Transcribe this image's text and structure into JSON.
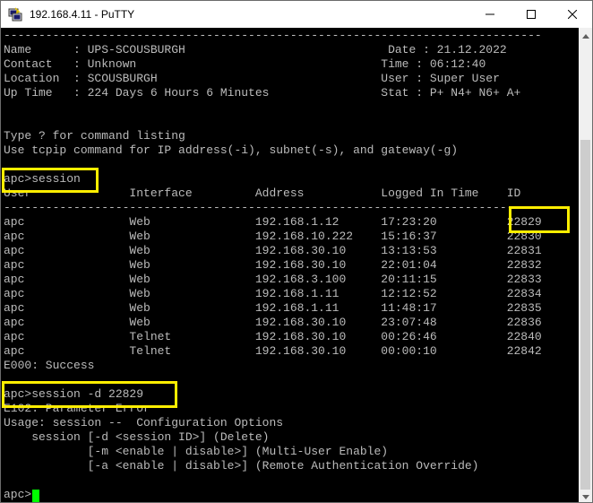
{
  "window": {
    "title": "192.168.4.11 - PuTTY",
    "icon": "putty-app-icon"
  },
  "terminal": {
    "lines": [
      "-----------------------------------------------------------------------------",
      "Name      : UPS-SCOUSBURGH                             Date : 21.12.2022",
      "Contact   : Unknown                                   Time : 06:12:40",
      "Location  : SCOUSBURGH                                User : Super User",
      "Up Time   : 224 Days 6 Hours 6 Minutes                Stat : P+ N4+ N6+ A+",
      "",
      "",
      "Type ? for command listing",
      "Use tcpip command for IP address(-i), subnet(-s), and gateway(-g)",
      "",
      "apc>session",
      "User              Interface         Address           Logged In Time    ID",
      "-----------------------------------------------------------------------------",
      "apc               Web               192.168.1.12      17:23:20          22829",
      "apc               Web               192.168.10.222    15:16:37          22830",
      "apc               Web               192.168.30.10     13:13:53          22831",
      "apc               Web               192.168.30.10     22:01:04          22832",
      "apc               Web               192.168.3.100     20:11:15          22833",
      "apc               Web               192.168.1.11      12:12:52          22834",
      "apc               Web               192.168.1.11      11:48:17          22835",
      "apc               Web               192.168.30.10     23:07:48          22836",
      "apc               Telnet            192.168.30.10     00:26:46          22840",
      "apc               Telnet            192.168.30.10     00:00:10          22842",
      "E000: Success",
      "",
      "apc>session -d 22829",
      "E102: Parameter Error",
      "Usage: session --  Configuration Options",
      "    session [-d <session ID>] (Delete)",
      "            [-m <enable | disable>] (Multi-User Enable)",
      "            [-a <enable | disable>] (Remote Authentication Override)",
      "",
      "apc>"
    ]
  },
  "colors": {
    "terminal_bg": "#000000",
    "terminal_text": "#bbbbbb",
    "cursor": "#00ff00",
    "highlight": "#ffee00"
  }
}
